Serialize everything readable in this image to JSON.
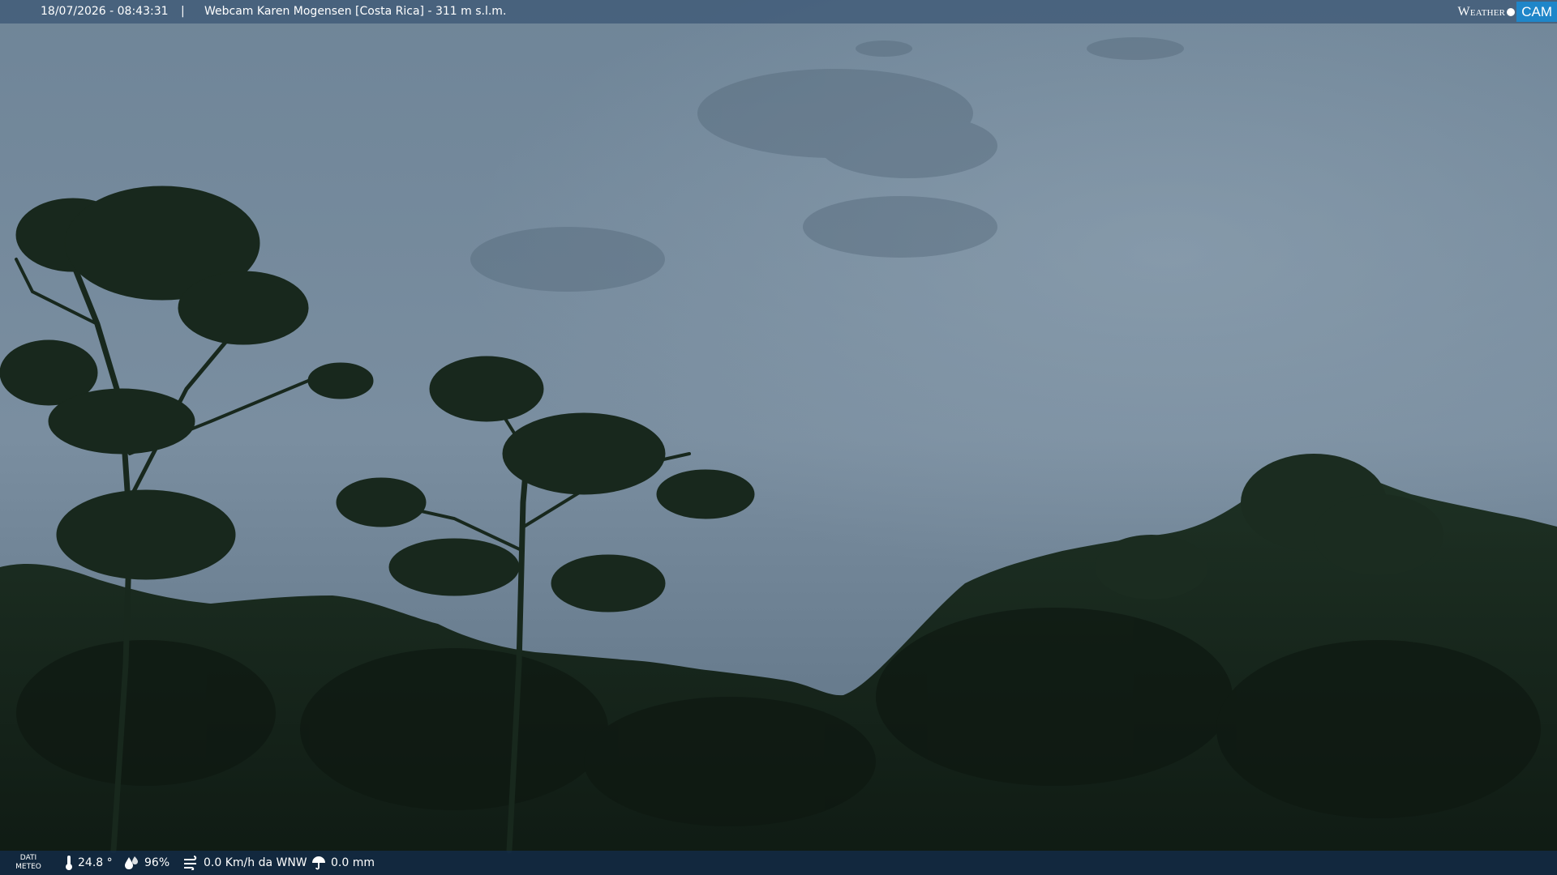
{
  "overlay": {
    "timestamp": "18/07/2026 - 08:43:31",
    "separator": "|",
    "camera_title": "Webcam Karen Mogensen [Costa Rica]  - 311 m s.l.m."
  },
  "logo": {
    "word": "Weather",
    "cam": "CAM",
    "accent_color": "#1f86c9"
  },
  "meteo": {
    "label_line1": "DATI",
    "label_line2": "METEO",
    "temperature": "24.8 °",
    "humidity": "96%",
    "wind": "0.0 Km/h da WNW",
    "rain": "0.0 mm",
    "icons": [
      "thermometer-icon",
      "humidity-drop-icon",
      "wind-icon",
      "rain-umbrella-icon"
    ]
  },
  "colors": {
    "sky_top": "#6f8598",
    "sky_bottom": "#5a7084",
    "vegetation": "#17261c"
  }
}
